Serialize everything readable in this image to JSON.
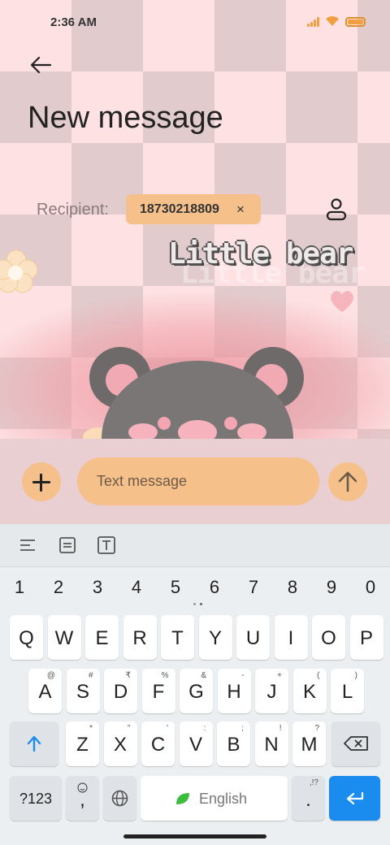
{
  "status_bar": {
    "time": "2:36 AM"
  },
  "header": {
    "title": "New message"
  },
  "recipient": {
    "label": "Recipient:",
    "chip_number": "18730218809",
    "chip_remove": "×"
  },
  "wallpaper": {
    "deco_text": "Little bear"
  },
  "compose": {
    "placeholder": "Text message"
  },
  "keyboard": {
    "numbers": [
      "1",
      "2",
      "3",
      "4",
      "5",
      "6",
      "7",
      "8",
      "9",
      "0"
    ],
    "row1": [
      "Q",
      "W",
      "E",
      "R",
      "T",
      "Y",
      "U",
      "I",
      "O",
      "P"
    ],
    "row2": [
      {
        "key": "A",
        "sub": "@"
      },
      {
        "key": "S",
        "sub": "#"
      },
      {
        "key": "D",
        "sub": "₹"
      },
      {
        "key": "F",
        "sub": "%"
      },
      {
        "key": "G",
        "sub": "&"
      },
      {
        "key": "H",
        "sub": "-"
      },
      {
        "key": "J",
        "sub": "+"
      },
      {
        "key": "K",
        "sub": "("
      },
      {
        "key": "L",
        "sub": ")"
      }
    ],
    "row3": [
      {
        "key": "Z",
        "sub": "*"
      },
      {
        "key": "X",
        "sub": "\""
      },
      {
        "key": "C",
        "sub": "'"
      },
      {
        "key": "V",
        "sub": ":"
      },
      {
        "key": "B",
        "sub": ";"
      },
      {
        "key": "N",
        "sub": "!"
      },
      {
        "key": "M",
        "sub": "?"
      }
    ],
    "symbols_key": "?123",
    "comma": ",",
    "space_label": "English",
    "period": ".",
    "period_sub": ",!?"
  },
  "colors": {
    "accent": "#f5c08a",
    "enter": "#1a8cf0",
    "wallpaper_light": "#fde1e3",
    "wallpaper_dark": "#e2cbcd"
  }
}
